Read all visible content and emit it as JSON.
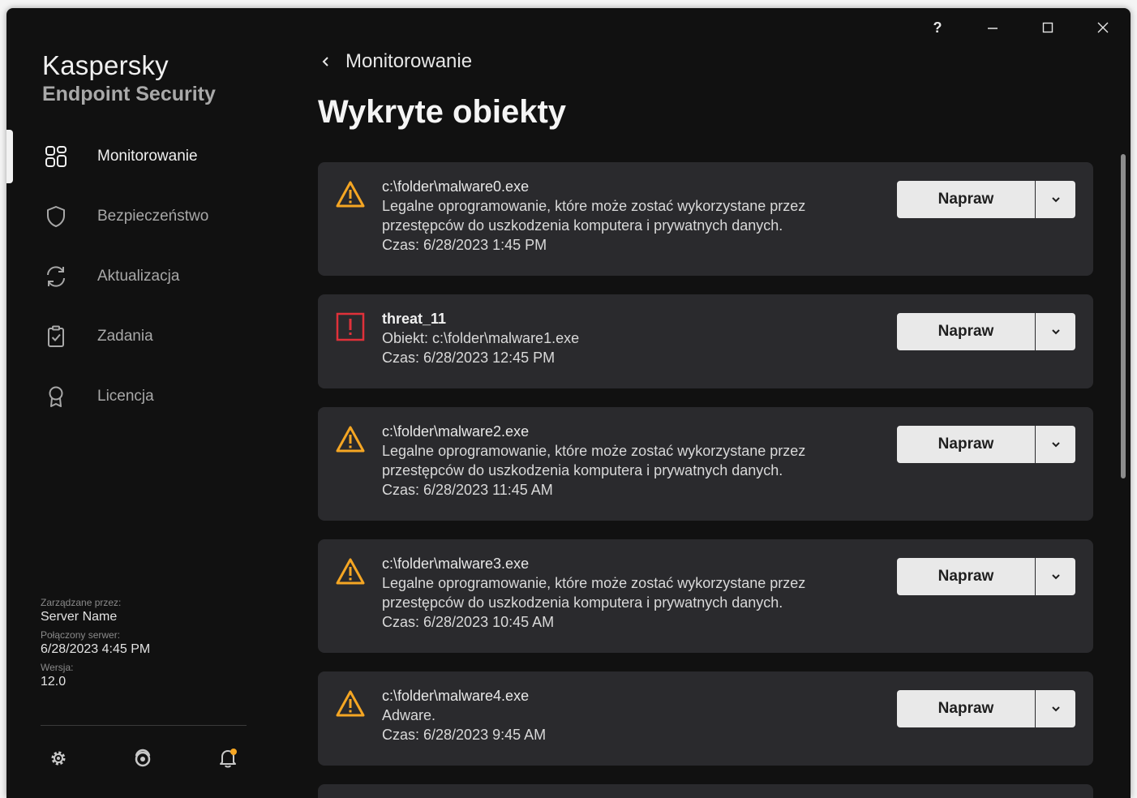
{
  "window": {
    "help_label": "?"
  },
  "brand": {
    "line1": "Kaspersky",
    "line2": "Endpoint Security"
  },
  "nav": {
    "items": [
      {
        "label": "Monitorowanie",
        "icon": "dashboard-icon",
        "active": true
      },
      {
        "label": "Bezpieczeństwo",
        "icon": "shield-icon"
      },
      {
        "label": "Aktualizacja",
        "icon": "refresh-icon"
      },
      {
        "label": "Zadania",
        "icon": "clipboard-icon"
      },
      {
        "label": "Licencja",
        "icon": "award-icon"
      }
    ]
  },
  "info": {
    "managed_label": "Zarządzane przez:",
    "managed_value": "Server Name",
    "server_label": "Połączony serwer:",
    "server_value": "6/28/2023 4:45 PM",
    "version_label": "Wersja:",
    "version_value": "12.0"
  },
  "bottom_icons": [
    "gear-icon",
    "support-icon",
    "notification-bell-icon"
  ],
  "header": {
    "back_label": "Monitorowanie",
    "title": "Wykryte obiekty"
  },
  "items": [
    {
      "severity": "warning",
      "title": "c:\\folder\\malware0.exe",
      "desc1": "Legalne oprogramowanie, które może zostać wykorzystane przez",
      "desc2": "przestępców do uszkodzenia komputera i prywatnych danych.",
      "time": "Czas: 6/28/2023 1:45 PM",
      "action": "Napraw"
    },
    {
      "severity": "critical",
      "title": "threat_11",
      "desc1": "Obiekt: c:\\folder\\malware1.exe",
      "time": "Czas: 6/28/2023 12:45 PM",
      "action": "Napraw"
    },
    {
      "severity": "warning",
      "title": "c:\\folder\\malware2.exe",
      "desc1": "Legalne oprogramowanie, które może zostać wykorzystane przez",
      "desc2": "przestępców do uszkodzenia komputera i prywatnych danych.",
      "time": "Czas: 6/28/2023 11:45 AM",
      "action": "Napraw"
    },
    {
      "severity": "warning",
      "title": "c:\\folder\\malware3.exe",
      "desc1": "Legalne oprogramowanie, które może zostać wykorzystane przez",
      "desc2": "przestępców do uszkodzenia komputera i prywatnych danych.",
      "time": "Czas: 6/28/2023 10:45 AM",
      "action": "Napraw"
    },
    {
      "severity": "warning",
      "title": "c:\\folder\\malware4.exe",
      "desc1": "Adware.",
      "time": "Czas: 6/28/2023 9:45 AM",
      "action": "Napraw"
    }
  ],
  "colors": {
    "background": "#111111",
    "card": "#2a2a2d",
    "warning": "#f5a623",
    "critical": "#e0313a",
    "button": "#e9e9e9",
    "notification_dot": "#f5a623"
  }
}
